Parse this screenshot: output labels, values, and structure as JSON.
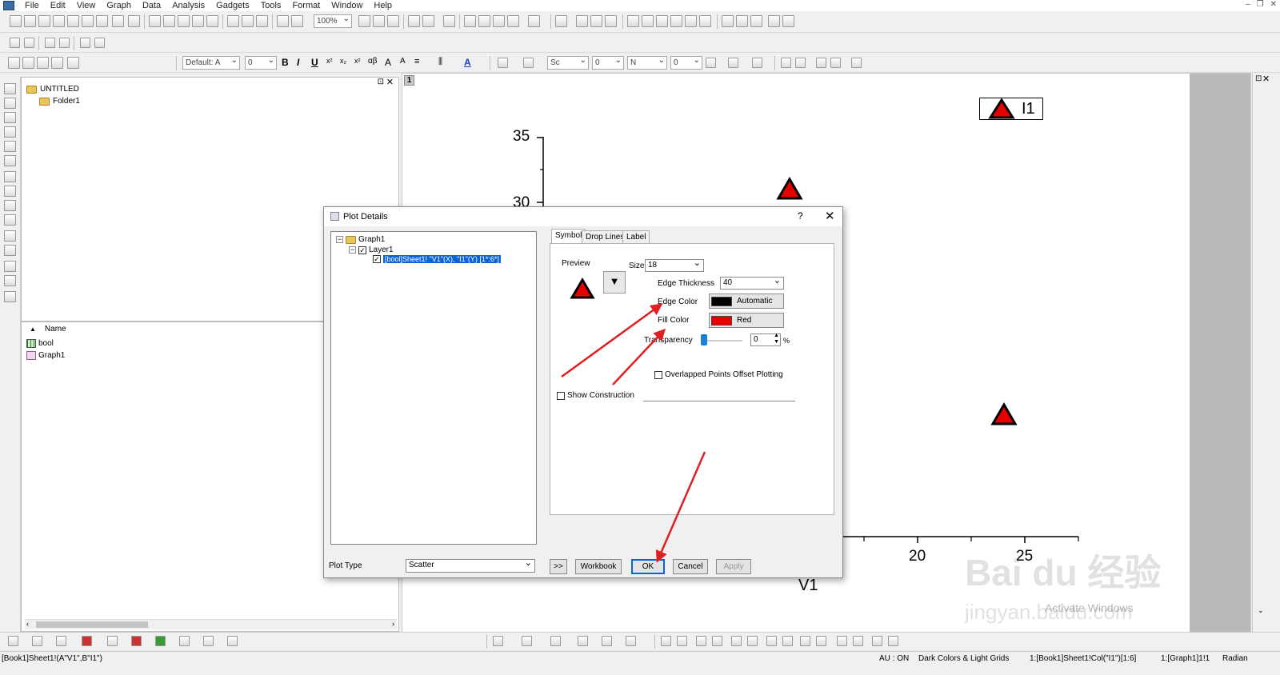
{
  "menu": {
    "items": [
      "File",
      "Edit",
      "View",
      "Graph",
      "Data",
      "Analysis",
      "Gadgets",
      "Tools",
      "Format",
      "Window",
      "Help"
    ]
  },
  "toolbar": {
    "zoom_value": "100%",
    "font_name": "Default: A",
    "font_size": "0",
    "line_width": "0",
    "border_width": "0",
    "line_style_label": "Sc",
    "fill_label": "N"
  },
  "project_explorer": {
    "root": "UNTITLED",
    "folder": "Folder1",
    "list_header": "Name",
    "items": [
      {
        "label": "bool",
        "icon": "workbook-icon"
      },
      {
        "label": "Graph1",
        "icon": "graph-icon"
      }
    ]
  },
  "graph": {
    "layer_tab": "1",
    "y_ticks": [
      "35",
      "30"
    ],
    "x_ticks": [
      "20",
      "25"
    ],
    "x_axis_title": "V1",
    "legend_label": "I1",
    "symbol_color": "#e60000"
  },
  "dialog": {
    "title": "Plot Details",
    "help": "?",
    "close": "✕",
    "tree": {
      "graph": "Graph1",
      "layer": "Layer1",
      "plot": "[bool]Sheet1! \"V1\"(X), \"I1\"(Y) [1*:6*]"
    },
    "tabs": [
      "Symbol",
      "Drop Lines",
      "Label"
    ],
    "symbol": {
      "preview_label": "Preview",
      "size_label": "Size",
      "size_value": "18",
      "edge_thickness_label": "Edge Thickness",
      "edge_thickness_value": "40",
      "edge_color_label": "Edge Color",
      "edge_color_value": "Automatic",
      "edge_color_swatch": "#000000",
      "fill_color_label": "Fill Color",
      "fill_color_value": "Red",
      "fill_color_swatch": "#e60000",
      "transparency_label": "Transparency",
      "transparency_value": "0",
      "transparency_unit": "%",
      "overlap_label": "Overlapped Points Offset Plotting",
      "show_construction_label": "Show Construction"
    },
    "plot_type_label": "Plot Type",
    "plot_type_value": "Scatter",
    "buttons": {
      "expand": ">>",
      "workbook": "Workbook",
      "ok": "OK",
      "cancel": "Cancel",
      "apply": "Apply"
    }
  },
  "status": {
    "left": "[Book1]Sheet1!(A\"V1\",B\"I1\")",
    "au": "AU : ON",
    "theme": "Dark Colors & Light Grids",
    "book": "1:[Book1]Sheet1!Col(\"I1\")[1:6]",
    "graph": "1:[Graph1]1!1",
    "angle": "Radian"
  },
  "watermark": {
    "brand": "Bai du 经验",
    "site": "jingyan.baidu.com",
    "activate": "Activate Windows"
  }
}
